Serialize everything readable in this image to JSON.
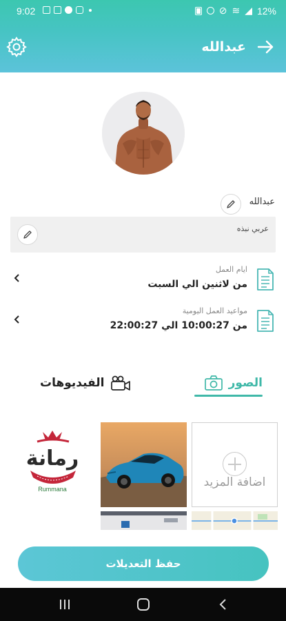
{
  "status_bar": {
    "time": "9:02",
    "battery": "12%"
  },
  "header": {
    "title": "عبدالله"
  },
  "profile": {
    "name": "عبدالله",
    "bio": "عربي نبذه"
  },
  "work_days": {
    "label": "ايام العمل",
    "value": "من لاثنين الي السبت"
  },
  "work_hours": {
    "label": "مواعيد العمل اليومية",
    "value": "من 10:00:27 الي 22:00:27"
  },
  "tabs": {
    "photos": "الصور",
    "videos": "الفيديوهات"
  },
  "gallery": {
    "add_more": "اضافة المزيد",
    "logo_text": "رمانة",
    "logo_sub": "Rummana"
  },
  "save_button": "حفظ التعديلات",
  "colors": {
    "accent": "#3fb8a8",
    "header_start": "#3cc7b0",
    "header_end": "#5cc3da",
    "icon_teal": "#49b7b4"
  }
}
